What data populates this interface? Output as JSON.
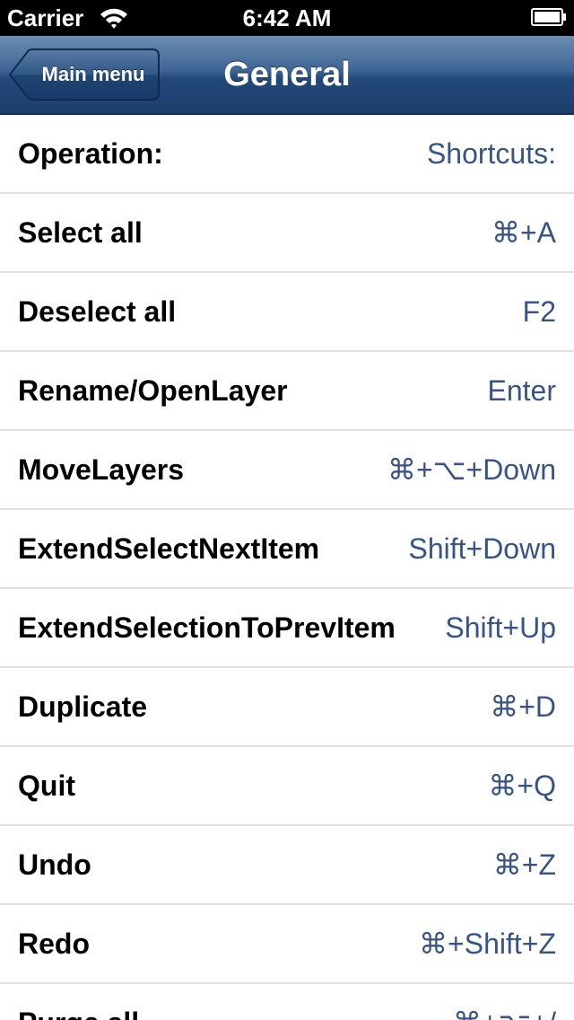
{
  "status_bar": {
    "carrier": "Carrier",
    "time": "6:42 AM",
    "icons": [
      "wifi-icon",
      "battery-icon"
    ]
  },
  "nav_bar": {
    "back_label": "Main menu",
    "title": "General"
  },
  "colors": {
    "nav_gradient_top": "#6d8db2",
    "nav_gradient_bottom": "#1c3e6c",
    "value_text": "#385487",
    "separator": "#e0e0e0"
  },
  "table": {
    "header": {
      "operation": "Operation:",
      "shortcut": "Shortcuts:"
    },
    "rows": [
      {
        "operation": "Select all",
        "shortcut": "⌘+A"
      },
      {
        "operation": "Deselect all",
        "shortcut": "F2"
      },
      {
        "operation": "Rename/OpenLayer",
        "shortcut": "Enter"
      },
      {
        "operation": "MoveLayers",
        "shortcut": "⌘+⌥+Down"
      },
      {
        "operation": "ExtendSelectNextItem",
        "shortcut": "Shift+Down"
      },
      {
        "operation": "ExtendSelectionToPrevItem",
        "shortcut": "Shift+Up"
      },
      {
        "operation": "Duplicate",
        "shortcut": "⌘+D"
      },
      {
        "operation": "Quit",
        "shortcut": "⌘+Q"
      },
      {
        "operation": "Undo",
        "shortcut": "⌘+Z"
      },
      {
        "operation": "Redo",
        "shortcut": "⌘+Shift+Z"
      },
      {
        "operation": "Purge all",
        "shortcut": "⌘+⌥+/"
      }
    ]
  }
}
